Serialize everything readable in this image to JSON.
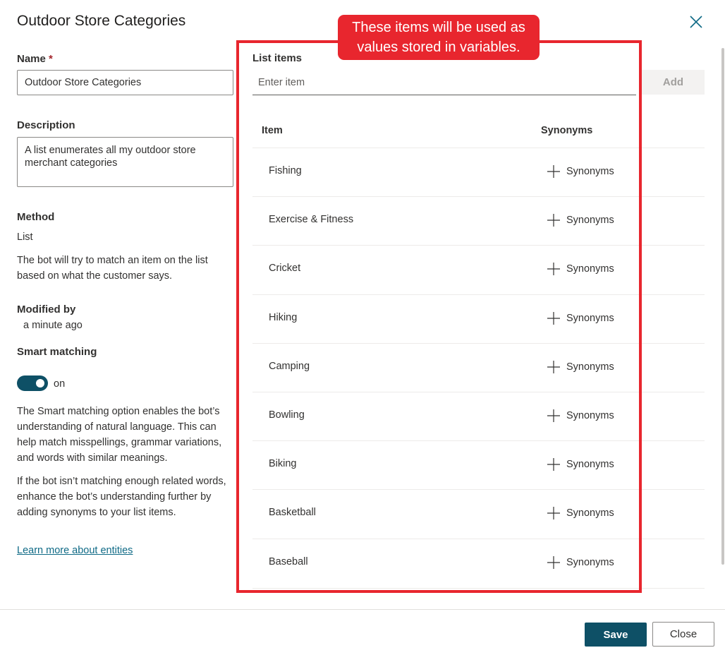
{
  "panel": {
    "title": "Outdoor Store Categories",
    "close_icon": "close-icon"
  },
  "name_field": {
    "label": "Name",
    "required_mark": "*",
    "value": "Outdoor Store Categories"
  },
  "description_field": {
    "label": "Description",
    "value": "A list enumerates all my outdoor store merchant categories"
  },
  "method": {
    "label": "Method",
    "value": "List",
    "help": "The bot will try to match an item on the list based on what the customer says."
  },
  "modified": {
    "label": "Modified by",
    "value": "a minute ago"
  },
  "smart_matching": {
    "label": "Smart matching",
    "state_label": "on",
    "enabled": true,
    "help1": "The Smart matching option enables the bot’s understanding of natural language. This can help match misspellings, grammar variations, and words with similar meanings.",
    "help2": "If the bot isn’t matching enough related words, enhance the bot’s understanding further by adding synonyms to your list items.",
    "learn_more": "Learn more about entities"
  },
  "list_items": {
    "label": "List items",
    "placeholder": "Enter item",
    "add_label": "Add",
    "col_item": "Item",
    "col_synonyms": "Synonyms",
    "rows": [
      {
        "name": "Fishing",
        "synonyms_label": "Synonyms"
      },
      {
        "name": "Exercise & Fitness",
        "synonyms_label": "Synonyms"
      },
      {
        "name": "Cricket",
        "synonyms_label": "Synonyms"
      },
      {
        "name": "Hiking",
        "synonyms_label": "Synonyms"
      },
      {
        "name": "Camping",
        "synonyms_label": "Synonyms"
      },
      {
        "name": "Bowling",
        "synonyms_label": "Synonyms"
      },
      {
        "name": "Biking",
        "synonyms_label": "Synonyms"
      },
      {
        "name": "Basketball",
        "synonyms_label": "Synonyms"
      },
      {
        "name": "Baseball",
        "synonyms_label": "Synonyms"
      }
    ]
  },
  "footer": {
    "save_label": "Save",
    "close_label": "Close"
  },
  "annotation": {
    "text": "These items will be used as values stored in variables.",
    "color": "#e8262e"
  },
  "colors": {
    "accent": "#0e5066",
    "link": "#0f6a86"
  }
}
